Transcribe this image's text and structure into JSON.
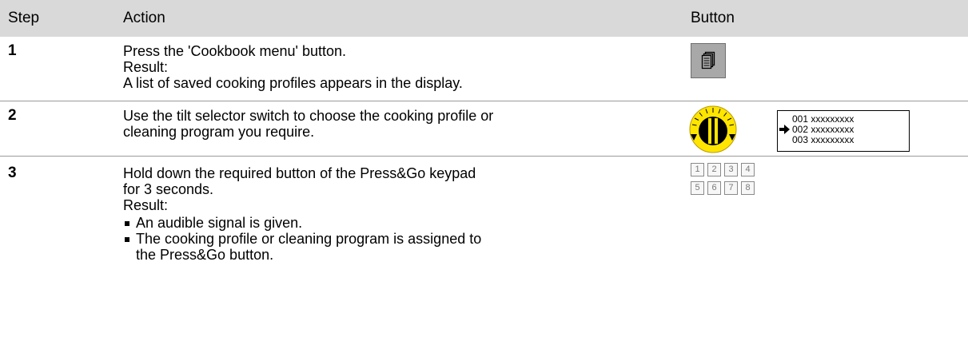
{
  "header": {
    "step": "Step",
    "action": "Action",
    "button": "Button"
  },
  "rows": [
    {
      "step": "1",
      "text": "Press the 'Cookbook menu' button.",
      "result_label": "Result:",
      "result_text": "A list of saved cooking profiles appears in the display.",
      "button_icon": "cookbook-menu-icon"
    },
    {
      "step": "2",
      "text_line1": "Use the tilt selector switch to choose the cooking profile or",
      "text_line2": "cleaning program you require.",
      "button_icon": "tilt-selector-dial-icon",
      "display": {
        "line1": "001 xxxxxxxxx",
        "line2": "002 xxxxxxxxx",
        "line3": "003 xxxxxxxxx"
      }
    },
    {
      "step": "3",
      "text_line1": "Hold down the required button of the Press&Go keypad",
      "text_line2": "for 3 seconds.",
      "result_label": "Result:",
      "bullets": [
        {
          "line1": "An audible signal is given."
        },
        {
          "line1": "The cooking profile or cleaning program is assigned to",
          "line2": "the Press&Go button."
        }
      ],
      "keypad": {
        "row1": [
          "1",
          "2",
          "3",
          "4"
        ],
        "row2": [
          "5",
          "6",
          "7",
          "8"
        ]
      }
    }
  ],
  "colors": {
    "header_bg": "#d9d9d9",
    "dial_yellow": "#ffe500",
    "button_gray": "#a8a8a8"
  }
}
